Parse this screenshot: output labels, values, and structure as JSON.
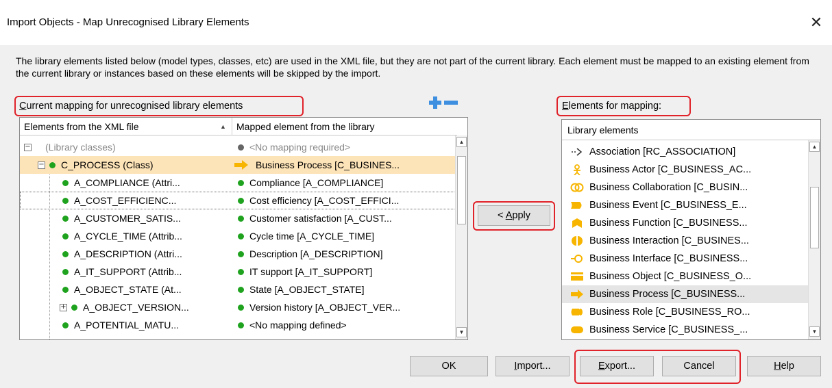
{
  "dialog": {
    "title": "Import Objects - Map Unrecognised Library Elements",
    "description": "The library elements listed below (model types, classes, etc) are used in the XML file, but they are not part of the current library. Each element must be mapped to an existing element from the current library or instances based on these elements will be skipped by the import."
  },
  "mapping": {
    "label_accel": "C",
    "label_rest": "urrent mapping for unrecognised library elements",
    "col_source": "Elements from the XML file",
    "col_target": "Mapped element from the library",
    "sort_arrow": "▲",
    "rows": [
      {
        "source": "(Library classes)",
        "target": "<No mapping required>"
      },
      {
        "source": "C_PROCESS (Class)",
        "target": "Business Process [C_BUSINES..."
      },
      {
        "source": "A_COMPLIANCE (Attri...",
        "target": "Compliance [A_COMPLIANCE]"
      },
      {
        "source": "A_COST_EFFICIENC...",
        "target": "Cost efficiency [A_COST_EFFICI..."
      },
      {
        "source": "A_CUSTOMER_SATIS...",
        "target": "Customer satisfaction [A_CUST..."
      },
      {
        "source": "A_CYCLE_TIME (Attrib...",
        "target": "Cycle time [A_CYCLE_TIME]"
      },
      {
        "source": "A_DESCRIPTION (Attri...",
        "target": "Description [A_DESCRIPTION]"
      },
      {
        "source": "A_IT_SUPPORT (Attrib...",
        "target": "IT support [A_IT_SUPPORT]"
      },
      {
        "source": "A_OBJECT_STATE (At...",
        "target": "State [A_OBJECT_STATE]"
      },
      {
        "source": "A_OBJECT_VERSION...",
        "target": "Version history [A_OBJECT_VER..."
      },
      {
        "source": "A_POTENTIAL_MATU...",
        "target": "<No mapping defined>"
      }
    ]
  },
  "apply": {
    "accel": "A",
    "rest": "pply",
    "prefix": "< "
  },
  "library": {
    "label_accel": "E",
    "label_rest": "lements for mapping:",
    "header": "Library elements",
    "items": [
      {
        "label": "Association [RC_ASSOCIATION]",
        "icon": "association-arrow-icon"
      },
      {
        "label": "Business Actor [C_BUSINESS_AC...",
        "icon": "business-actor-icon"
      },
      {
        "label": "Business Collaboration [C_BUSIN...",
        "icon": "business-collaboration-icon"
      },
      {
        "label": "Business Event [C_BUSINESS_E...",
        "icon": "business-event-icon"
      },
      {
        "label": "Business Function [C_BUSINESS...",
        "icon": "business-function-icon"
      },
      {
        "label": "Business Interaction [C_BUSINES...",
        "icon": "business-interaction-icon"
      },
      {
        "label": "Business Interface [C_BUSINESS...",
        "icon": "business-interface-icon"
      },
      {
        "label": "Business Object [C_BUSINESS_O...",
        "icon": "business-object-icon"
      },
      {
        "label": "Business Process [C_BUSINESS...",
        "icon": "business-process-icon"
      },
      {
        "label": "Business Role [C_BUSINESS_RO...",
        "icon": "business-role-icon"
      },
      {
        "label": "Business Service [C_BUSINESS_...",
        "icon": "business-service-icon"
      }
    ]
  },
  "buttons": {
    "ok": "OK",
    "import_accel": "I",
    "import_rest": "mport...",
    "export_accel": "E",
    "export_rest": "xport...",
    "cancel": "Cancel",
    "help_accel": "H",
    "help_rest": "elp"
  },
  "colors": {
    "highlight_red": "#e0222a",
    "icon_yellow": "#f7b500",
    "selected_row": "#fde3b8",
    "ok_green": "#1fa31f"
  }
}
